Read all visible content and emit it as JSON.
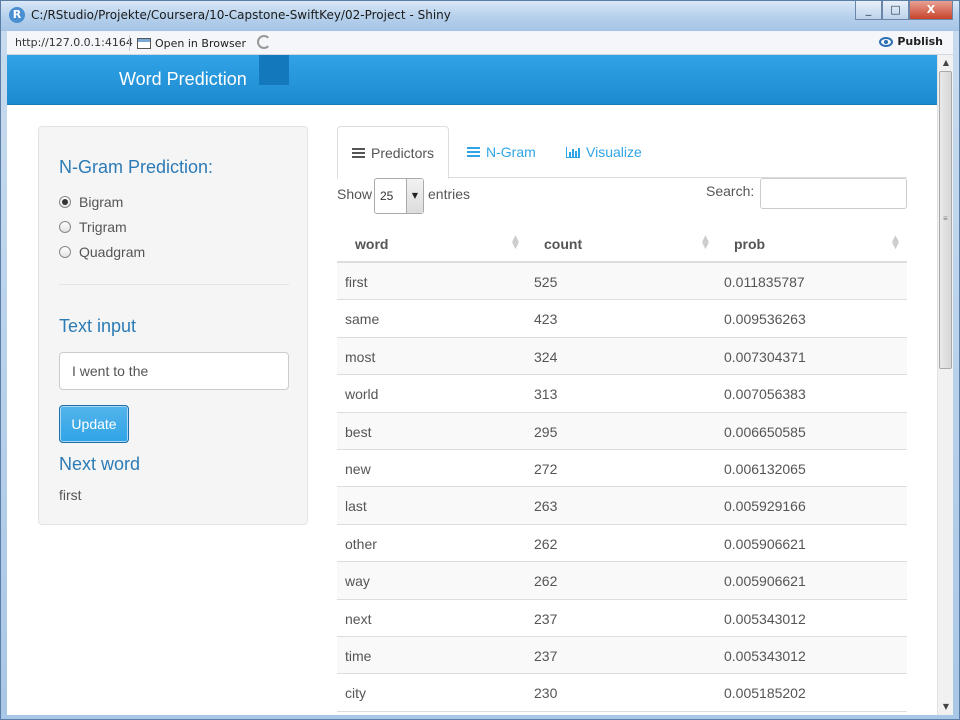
{
  "window": {
    "title": "C:/RStudio/Projekte/Coursera/10-Capstone-SwiftKey/02-Project - Shiny",
    "icon": "r-icon",
    "controls": {
      "minimize": "_",
      "maximize": "□",
      "close": "X"
    }
  },
  "toolbar": {
    "url": "http://127.0.0.1:4164",
    "open_in_browser": "Open in Browser",
    "publish": "Publish"
  },
  "navbar": {
    "brand": "Word Prediction",
    "color": "#2fa4e7"
  },
  "sidebar": {
    "ngram_heading": "N-Gram Prediction:",
    "options": [
      {
        "label": "Bigram",
        "checked": true
      },
      {
        "label": "Trigram",
        "checked": false
      },
      {
        "label": "Quadgram",
        "checked": false
      }
    ],
    "text_input_heading": "Text input",
    "text_input_value": "I went to the",
    "update_button": "Update",
    "next_word_heading": "Next word",
    "next_word_value": "first"
  },
  "tabs": [
    {
      "label": "Predictors",
      "icon": "list-icon",
      "active": true
    },
    {
      "label": "N-Gram",
      "icon": "list-icon",
      "active": false
    },
    {
      "label": "Visualize",
      "icon": "bar-chart-icon",
      "active": false
    }
  ],
  "table_controls": {
    "show_label": "Show",
    "entries_value": "25",
    "entries_label": "entries",
    "search_label": "Search:",
    "search_value": ""
  },
  "table": {
    "columns": [
      "word",
      "count",
      "prob"
    ],
    "rows": [
      [
        "first",
        "525",
        "0.011835787"
      ],
      [
        "same",
        "423",
        "0.009536263"
      ],
      [
        "most",
        "324",
        "0.007304371"
      ],
      [
        "world",
        "313",
        "0.007056383"
      ],
      [
        "best",
        "295",
        "0.006650585"
      ],
      [
        "new",
        "272",
        "0.006132065"
      ],
      [
        "last",
        "263",
        "0.005929166"
      ],
      [
        "other",
        "262",
        "0.005906621"
      ],
      [
        "way",
        "262",
        "0.005906621"
      ],
      [
        "next",
        "237",
        "0.005343012"
      ],
      [
        "time",
        "237",
        "0.005343012"
      ],
      [
        "city",
        "230",
        "0.005185202"
      ]
    ]
  }
}
